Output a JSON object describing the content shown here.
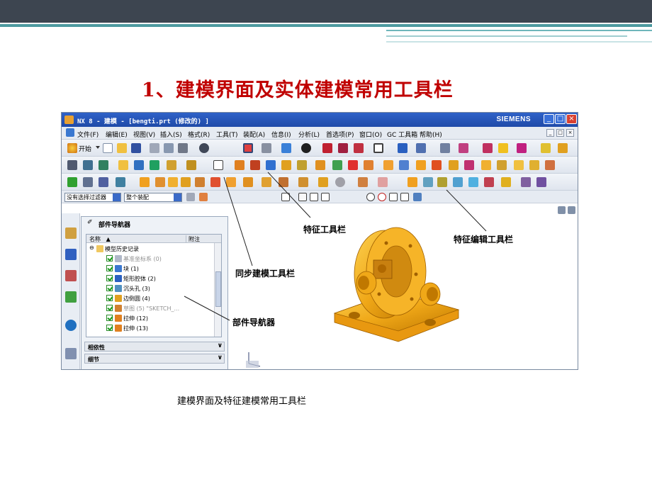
{
  "slide": {
    "title": "1、建模界面及实体建模常用工具栏",
    "caption": "建模界面及特征建模常用工具栏"
  },
  "window": {
    "title": "NX 8 - 建模 - [bengti.prt  (修改的)  ]",
    "brand": "SIEMENS",
    "controls": [
      "_",
      "□",
      "×"
    ]
  },
  "menu": {
    "items": [
      "文件(F)",
      "编辑(E)",
      "视图(V)",
      "插入(S)",
      "格式(R)",
      "工具(T)",
      "装配(A)",
      "信息(I)",
      "分析(L)",
      "首选项(P)",
      "窗口(O)",
      "GC 工具箱",
      "帮助(H)"
    ]
  },
  "toolbar": {
    "start_label": "开始"
  },
  "filters": {
    "selection_filter": "没有选择过滤器",
    "assembly_scope": "整个装配"
  },
  "part_navigator": {
    "title": "部件导航器",
    "columns": {
      "name": "名称",
      "sort_indicator": "▲",
      "attachment": "附注"
    },
    "root": "模型历史记录",
    "items": [
      {
        "label": "基准坐标系 (0)",
        "muted": true
      },
      {
        "label": "块 (1)",
        "muted": false
      },
      {
        "label": "矩形腔体 (2)",
        "muted": false
      },
      {
        "label": "沉头孔 (3)",
        "muted": false
      },
      {
        "label": "边倒圆 (4)",
        "muted": false
      },
      {
        "label": "草图 (5) \"SKETCH_...",
        "muted": true
      },
      {
        "label": "拉伸 (12)",
        "muted": false
      },
      {
        "label": "拉伸 (13)",
        "muted": false
      }
    ],
    "sections": [
      "相依性",
      "细节"
    ]
  },
  "annotations": {
    "feature_toolbar": "特征工具栏",
    "feature_edit_toolbar": "特征编辑工具栏",
    "sync_toolbar": "同步建模工具栏",
    "part_navigator": "部件导航器"
  },
  "colors": {
    "title_red": "#c00000",
    "header_dark": "#3d4550",
    "accent_teal": "#4d9aa0",
    "model_orange": "#f0a818"
  }
}
